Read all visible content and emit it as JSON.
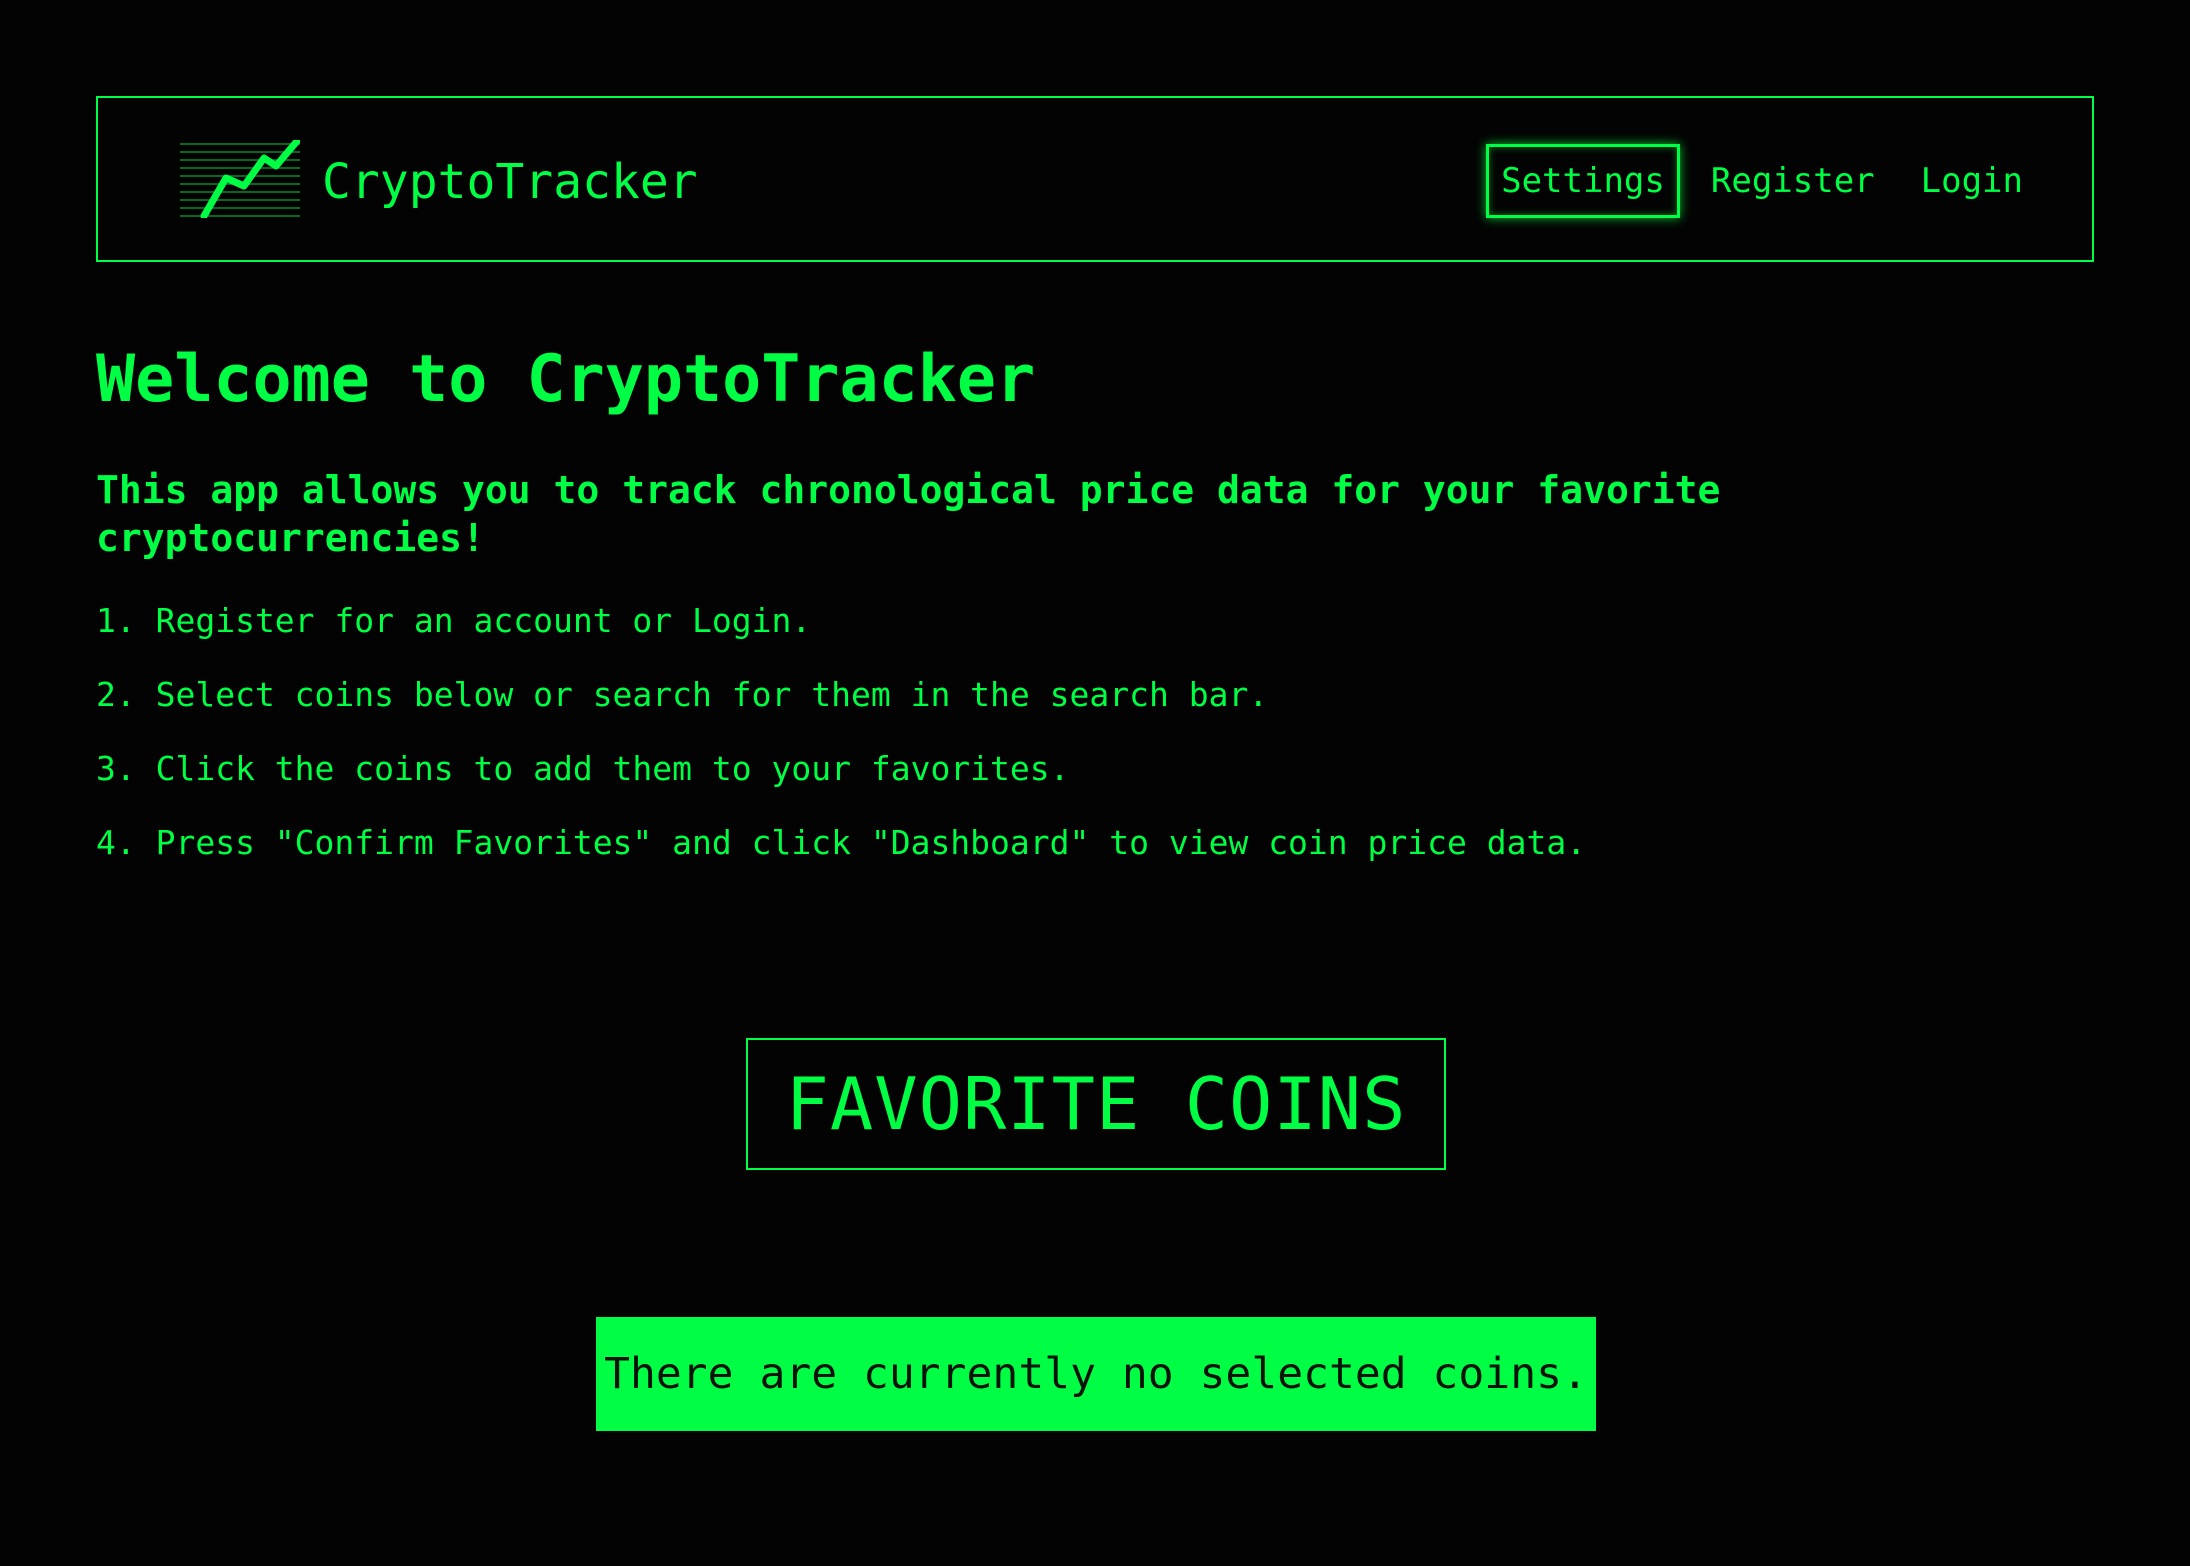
{
  "navbar": {
    "logo_icon": "rising-chart-icon",
    "brand": "CryptoTracker",
    "links": [
      {
        "label": "Settings",
        "active": true
      },
      {
        "label": "Register",
        "active": false
      },
      {
        "label": "Login",
        "active": false
      }
    ]
  },
  "main": {
    "title": "Welcome to CryptoTracker",
    "intro": "This app allows you to track chronological price data for your favorite cryptocurrencies!",
    "steps": [
      "1. Register for an account or Login.",
      "2. Select coins below or search for them in the search bar.",
      "3. Click the coins to add them to your favorites.",
      "4. Press \"Confirm Favorites\" and click \"Dashboard\" to view coin price data."
    ],
    "favorites_heading": "FAVORITE COINS",
    "empty_message": "There are currently no selected coins."
  },
  "colors": {
    "accent": "#00ff44",
    "background": "#030303",
    "banner_text": "#06130a"
  }
}
